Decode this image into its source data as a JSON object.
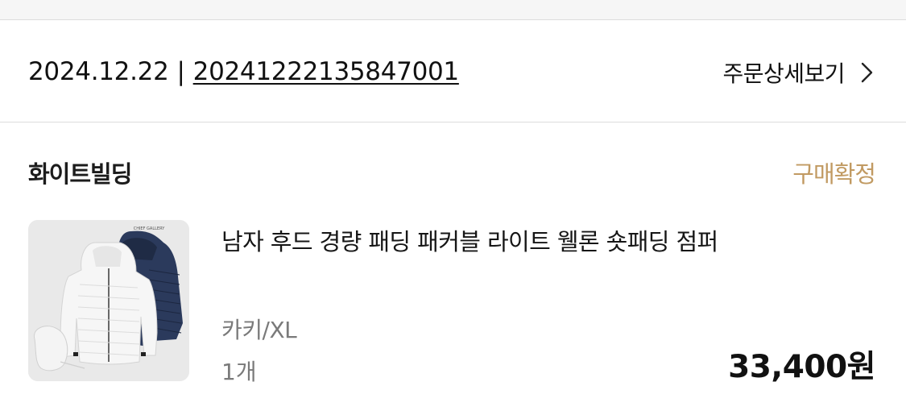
{
  "order": {
    "date": "2024.12.22",
    "separator": "|",
    "number": "20241222135847001",
    "detail_label": "주문상세보기"
  },
  "seller": {
    "name": "화이트빌딩"
  },
  "status": {
    "label": "구매확정",
    "color": "#c19a62"
  },
  "product": {
    "name": "남자 후드 경량 패딩 패커블 라이트 웰론 숏패딩 점퍼",
    "option": "카키/XL",
    "quantity": "1개",
    "price": "33,400원",
    "thumbnail_brand_text": "CHIEF GALLERY"
  }
}
